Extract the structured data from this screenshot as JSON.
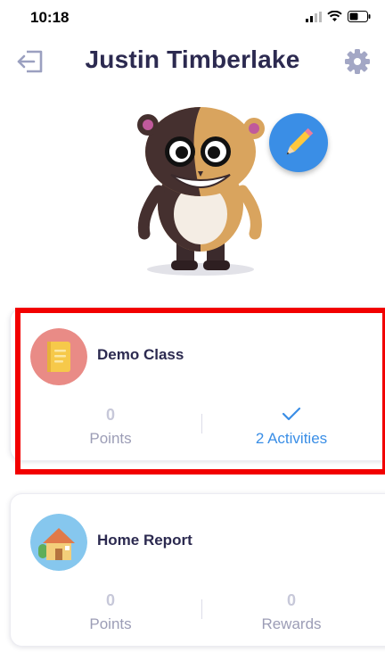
{
  "status_bar": {
    "time": "10:18"
  },
  "header": {
    "title": "Justin Timberlake",
    "back_icon": "logout-icon",
    "settings_icon": "gear-icon"
  },
  "avatar": {
    "icon": "hamster-monster-avatar",
    "edit_icon": "pencil-icon"
  },
  "cards": [
    {
      "title": "Demo Class",
      "icon": "notebook-icon",
      "icon_color": "#e98b86",
      "left_stat": {
        "value": "0",
        "label": "Points"
      },
      "right_stat": {
        "icon": "checkmark-icon",
        "label": "2 Activities"
      }
    },
    {
      "title": "Home Report",
      "icon": "house-icon",
      "icon_color": "#86c7ee",
      "left_stat": {
        "value": "0",
        "label": "Points"
      },
      "right_stat": {
        "value": "0",
        "label": "Rewards"
      }
    }
  ],
  "colors": {
    "accent": "#3a8ee6",
    "title": "#2c2a50",
    "muted": "#9c9db6",
    "highlight": "#f20000"
  }
}
